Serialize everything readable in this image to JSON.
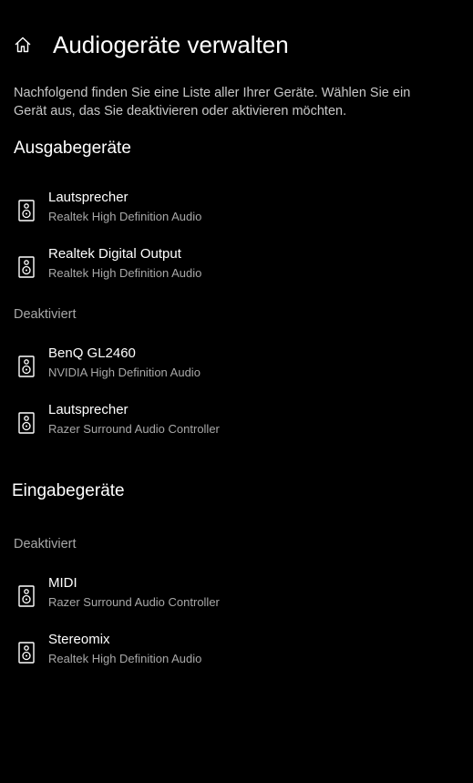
{
  "header": {
    "title": "Audiogeräte verwalten",
    "home_icon": "home-icon"
  },
  "description": "Nachfolgend finden Sie eine Liste aller Ihrer Geräte. Wählen Sie ein Gerät aus, das Sie deaktivieren oder aktivieren möchten.",
  "output": {
    "heading": "Ausgabegeräte",
    "active": [
      {
        "name": "Lautsprecher",
        "driver": "Realtek High Definition Audio",
        "icon": "speaker-icon"
      },
      {
        "name": "Realtek Digital Output",
        "driver": "Realtek High Definition Audio",
        "icon": "speaker-icon"
      }
    ],
    "disabled_label": "Deaktiviert",
    "disabled": [
      {
        "name": "BenQ GL2460",
        "driver": "NVIDIA High Definition Audio",
        "icon": "speaker-icon"
      },
      {
        "name": "Lautsprecher",
        "driver": "Razer Surround Audio Controller",
        "icon": "speaker-icon"
      }
    ]
  },
  "input": {
    "heading": "Eingabegeräte",
    "disabled_label": "Deaktiviert",
    "disabled": [
      {
        "name": "MIDI",
        "driver": "Razer Surround Audio Controller",
        "icon": "speaker-icon"
      },
      {
        "name": "Stereomix",
        "driver": "Realtek High Definition Audio",
        "icon": "speaker-icon"
      }
    ]
  },
  "colors": {
    "background": "#000000",
    "primary_text": "#ffffff",
    "secondary_text": "#a8a8a8"
  }
}
